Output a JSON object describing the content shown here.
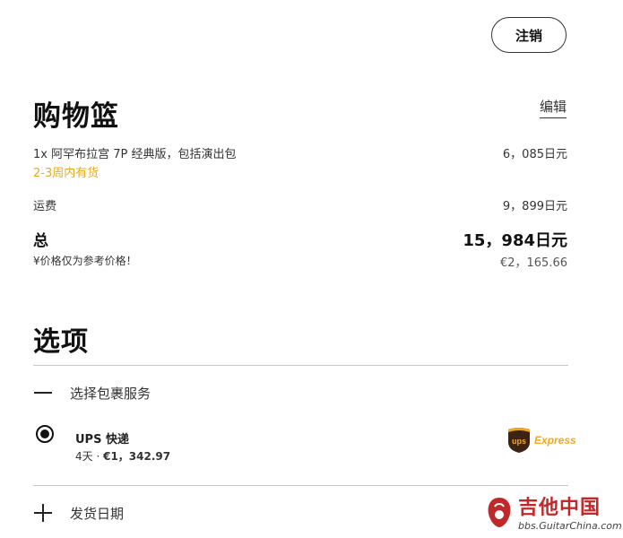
{
  "header": {
    "cancel_label": "注销"
  },
  "cart": {
    "title": "购物篮",
    "edit_label": "编辑",
    "item": {
      "description": "1x 阿罕布拉宫 7P 经典版，包括演出包",
      "price": "6，085日元",
      "availability": "2-3周内有货"
    },
    "shipping": {
      "label": "运费",
      "price": "9，899日元"
    },
    "total": {
      "label": "总",
      "value": "15，984日元",
      "note": "¥价格仅为参考价格！",
      "eur_value": "€2，165.66"
    }
  },
  "options": {
    "title": "选项",
    "parcel_section": {
      "label": "选择包裹服务",
      "expanded": true
    },
    "ups": {
      "name": "UPS 快递",
      "days": "4天 · ",
      "price": "€1，342.97",
      "selected": true,
      "logo_text": "Express",
      "logo_letters": "ups"
    },
    "delivery_section": {
      "label": "发货日期",
      "expanded": false
    }
  },
  "watermark": {
    "title": "吉他中国",
    "url": "bbs.GuitarChina.com"
  },
  "colors": {
    "availability": "#e8a91e",
    "ups_brown": "#3d2412",
    "ups_gold": "#f3a71d",
    "watermark_red": "#c0292a"
  }
}
